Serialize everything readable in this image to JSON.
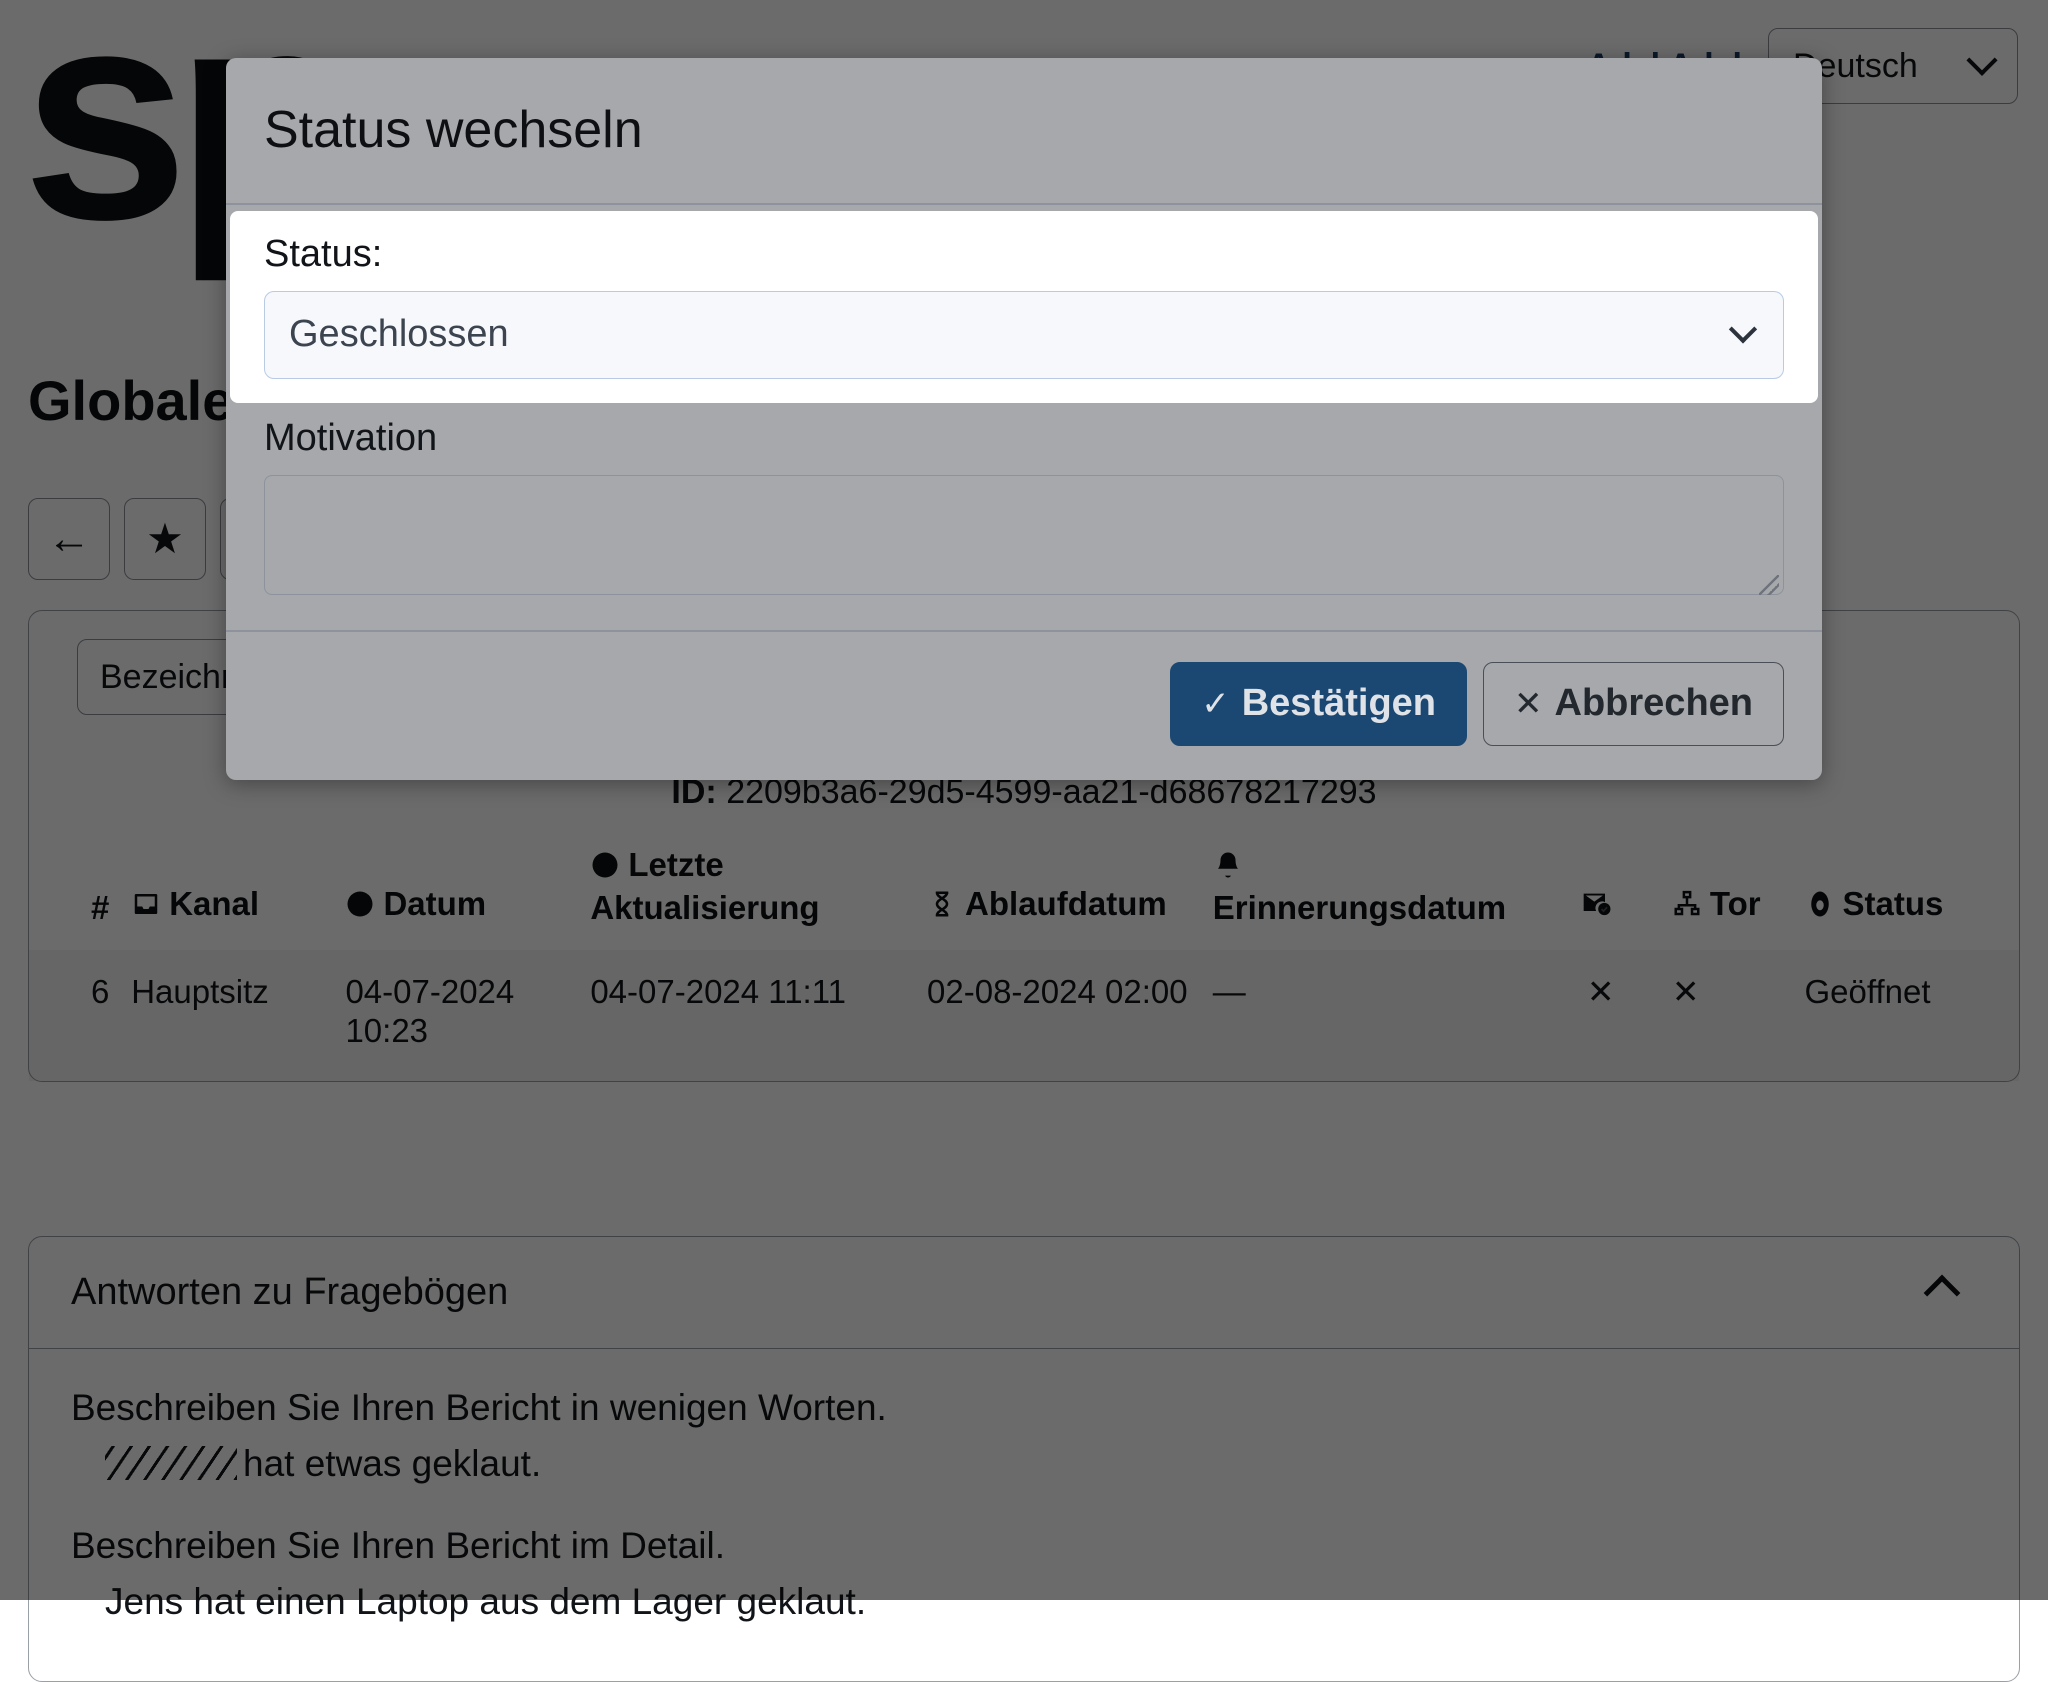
{
  "header": {
    "logo_text": "sp",
    "user_links": [
      "Adel Adel"
    ],
    "language_value": "Deutsch",
    "language_chevron_icon": "chevron-down-icon"
  },
  "page": {
    "title": "Globale"
  },
  "toolbar": {
    "back_icon": "arrow-left-icon",
    "back_glyph": "←",
    "favorite_icon": "star-icon",
    "favorite_glyph": "★"
  },
  "search": {
    "placeholder": "Bezeichnung",
    "value": ""
  },
  "record": {
    "id_label": "ID:",
    "id_value": "2209b3a6-29d5-4599-aa21-d68678217293"
  },
  "table": {
    "columns": [
      {
        "key": "num",
        "label": "#",
        "icon": ""
      },
      {
        "key": "kanal",
        "label": "Kanal",
        "icon": "inbox-icon"
      },
      {
        "key": "datum",
        "label": "Datum",
        "icon": "clock-icon"
      },
      {
        "key": "update",
        "label": "Letzte Aktualisierung",
        "icon": "clock-icon"
      },
      {
        "key": "expiry",
        "label": "Ablaufdatum",
        "icon": "hourglass-icon"
      },
      {
        "key": "remind",
        "label": "Erinnerungsdatum",
        "icon": "bell-icon"
      },
      {
        "key": "mail",
        "label": "",
        "icon": "mail-check-icon"
      },
      {
        "key": "tor",
        "label": "Tor",
        "icon": "sitemap-icon"
      },
      {
        "key": "status",
        "label": "Status",
        "icon": "circle-dot-icon"
      }
    ],
    "rows": [
      {
        "num": "6",
        "kanal": "Hauptsitz",
        "datum": "04-07-2024 10:23",
        "update": "04-07-2024 11:11",
        "expiry": "02-08-2024 02:00",
        "remind": "—",
        "mail": "✕",
        "tor": "✕",
        "status": "Geöffnet"
      }
    ]
  },
  "accordion": {
    "title": "Antworten zu Fragebögen",
    "toggle_icon": "chevron-up-icon",
    "items": [
      {
        "question": "Beschreiben Sie Ihren Bericht in wenigen Worten.",
        "answer_redacted": true,
        "answer": "hat etwas geklaut."
      },
      {
        "question": "Beschreiben Sie Ihren Bericht im Detail.",
        "answer_redacted": false,
        "answer": "Jens hat einen Laptop aus dem Lager geklaut."
      }
    ]
  },
  "modal": {
    "title": "Status wechseln",
    "status_label": "Status:",
    "status_value": "Geschlossen",
    "status_chevron_icon": "chevron-down-icon",
    "motivation_label": "Motivation",
    "motivation_value": "",
    "motivation_placeholder": "",
    "confirm_label": "Bestätigen",
    "confirm_icon": "check-icon",
    "confirm_glyph": "✓",
    "cancel_label": "Abbrechen",
    "cancel_icon": "close-icon",
    "cancel_glyph": "✕"
  },
  "colors": {
    "primary": "#1b4872",
    "link": "#1b3d63",
    "modal_bg": "#a6a8ab",
    "field_focus_border": "#b9cbe4"
  }
}
